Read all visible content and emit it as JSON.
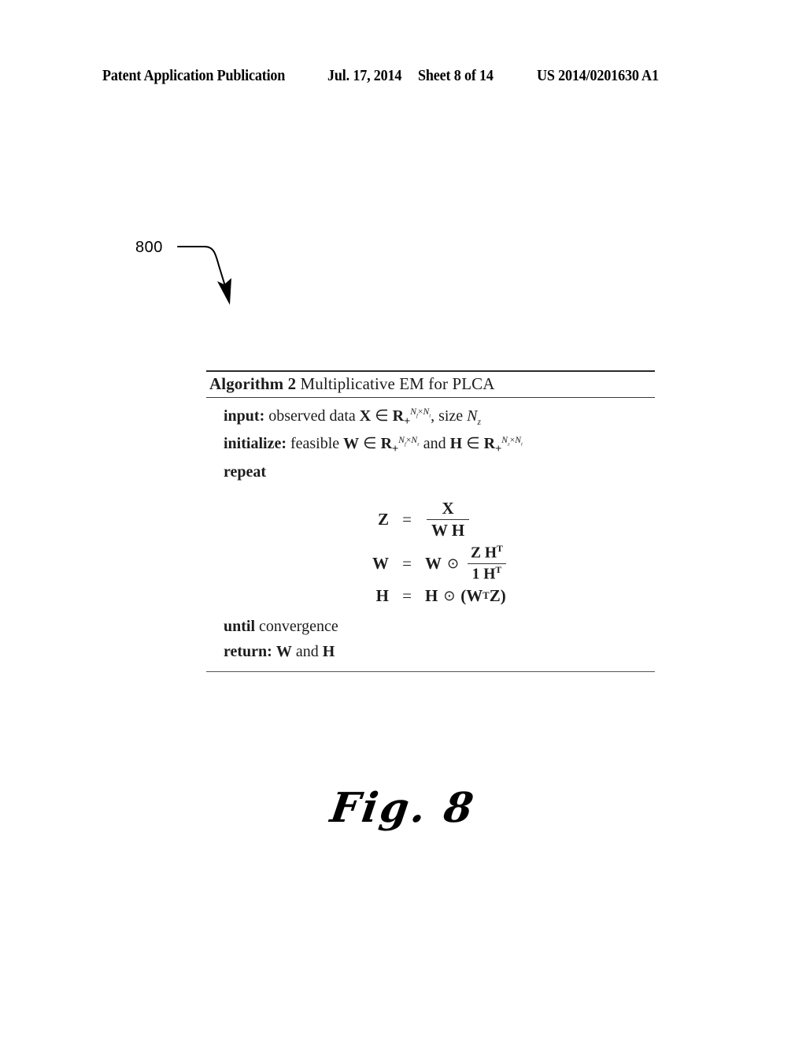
{
  "header": {
    "publication": "Patent Application Publication",
    "date": "Jul. 17, 2014",
    "sheet": "Sheet 8 of 14",
    "patent_number": "US 2014/0201630 A1"
  },
  "reference_numeral": {
    "label": "800",
    "leader_icon": "curved-arrow-icon"
  },
  "algorithm": {
    "title_keyword": "Algorithm 2",
    "title_rest": "Multiplicative EM for PLCA",
    "lines": {
      "input_keyword": "input:",
      "input_text": "observed data",
      "input_var": "X",
      "input_member": "∈",
      "input_space": "R",
      "input_space_sub": "+",
      "input_space_sup_1": "N",
      "input_space_sup_1_sub": "f",
      "input_space_sup_times": "×",
      "input_space_sup_2": "N",
      "input_space_sup_2_sub": "t",
      "input_size_text": ", size",
      "input_size_var": "N",
      "input_size_sub": "z",
      "init_keyword": "initialize:",
      "init_text": "feasible",
      "init_var_w": "W",
      "init_member_w": "∈",
      "init_space_w": "R",
      "init_space_w_sub": "+",
      "init_w_sup_1": "N",
      "init_w_sup_1_sub": "f",
      "init_w_sup_times": "×",
      "init_w_sup_2": "N",
      "init_w_sup_2_sub": "z",
      "init_and": "and",
      "init_var_h": "H",
      "init_member_h": "∈",
      "init_space_h": "R",
      "init_space_h_sub": "+",
      "init_h_sup_1": "N",
      "init_h_sup_1_sub": "z",
      "init_h_sup_times": "×",
      "init_h_sup_2": "N",
      "init_h_sup_2_sub": "t",
      "repeat_keyword": "repeat",
      "until_keyword": "until",
      "until_text": "convergence",
      "return_keyword": "return:",
      "return_text_1": "W",
      "return_and": "and",
      "return_text_2": "H"
    },
    "equations": [
      {
        "lhs": "Z",
        "eq": "=",
        "numerator": "X",
        "denominator": "W H"
      },
      {
        "lhs": "W",
        "eq": "=",
        "operand": "W",
        "operator": "⊙",
        "numerator": "Z H",
        "numerator_sup": "T",
        "denominator": "1 H",
        "denominator_sup": "T"
      },
      {
        "lhs": "H",
        "eq": "=",
        "operand": "H",
        "operator": "⊙",
        "paren_open": "(",
        "inner_1": "W",
        "inner_1_sup": "T",
        "inner_2": "Z",
        "paren_close": ")"
      }
    ]
  },
  "figure": {
    "caption": "Fig. 8"
  },
  "colors": {
    "page_background": "#ffffff",
    "text": "#000000",
    "rule": "#2a2a2a"
  }
}
